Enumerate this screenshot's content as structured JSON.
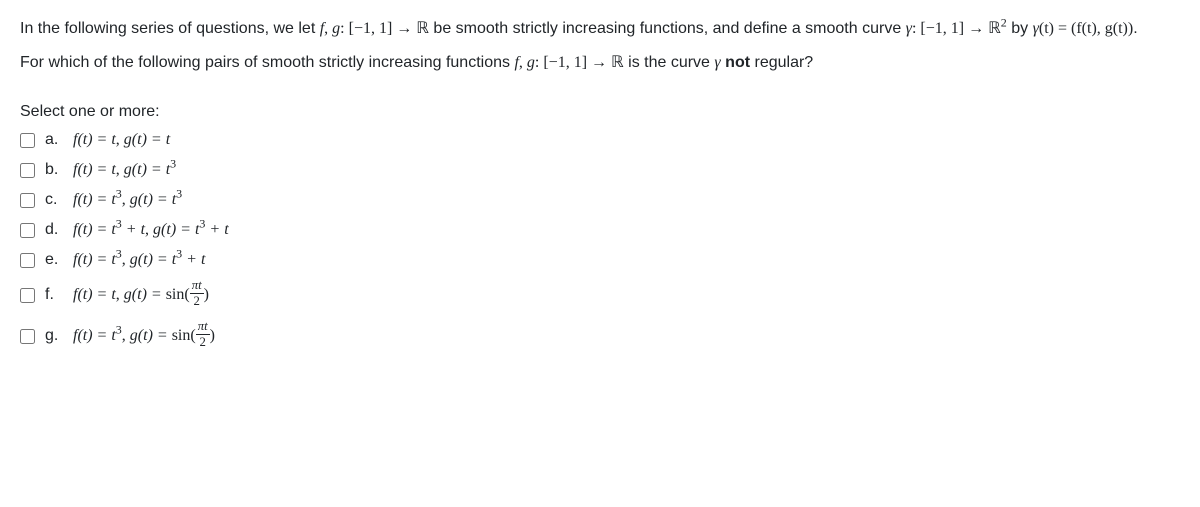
{
  "intro": {
    "p1_a": "In the following series of questions, we let ",
    "p1_b": " be smooth strictly increasing functions, and define a smooth curve ",
    "p1_c": " by ",
    "p1_d": "."
  },
  "prompt": {
    "a": "For which of the following pairs of smooth strictly increasing functions ",
    "b": " is the curve ",
    "c": " ",
    "not": "not",
    "d": " regular?"
  },
  "select_label": "Select one or more:",
  "math": {
    "fg_domain_pre": "f",
    "fg_domain_comma": ", ",
    "fg_domain_g": "g",
    "fg_domain_colon": ": [−1, 1] → ",
    "R": "ℝ",
    "gamma_def_pre": "γ",
    "gamma_def_colon": ": [−1, 1] → ",
    "R2_post": " ",
    "gamma_eq": "γ",
    "gamma_t": "(t) = (f(t), g(t))",
    "fg_domain2_pre": "f",
    "fg_domain2_g": "g",
    "fg_domain2_colon": ": [−1, 1] → ",
    "gamma_only": "γ",
    "sup2": "2",
    "sup3": "3"
  },
  "options": [
    {
      "letter": "a.",
      "f": "f(t) = t",
      "g": "g(t) = t"
    },
    {
      "letter": "b.",
      "f": "f(t) = t",
      "g_pre": "g(t) = t",
      "g_sup": "3"
    },
    {
      "letter": "c.",
      "f_pre": "f(t) = t",
      "f_sup": "3",
      "g_pre": "g(t) = t",
      "g_sup": "3"
    },
    {
      "letter": "d.",
      "f_pre": "f(t) = t",
      "f_sup": "3",
      "f_post": " + t",
      "g_pre": "g(t) = t",
      "g_sup": "3",
      "g_post": " + t"
    },
    {
      "letter": "e.",
      "f_pre": "f(t) = t",
      "f_sup": "3",
      "g_pre": "g(t) = t",
      "g_sup": "3",
      "g_post": " + t"
    },
    {
      "letter": "f.",
      "f": "f(t) = t",
      "g_fn": "g(t) = ",
      "sin": "sin",
      "frac_num": "πt",
      "frac_den": "2"
    },
    {
      "letter": "g.",
      "f_pre": "f(t) = t",
      "f_sup": "3",
      "g_fn": "g(t) = ",
      "sin": "sin",
      "frac_num": "πt",
      "frac_den": "2"
    }
  ]
}
